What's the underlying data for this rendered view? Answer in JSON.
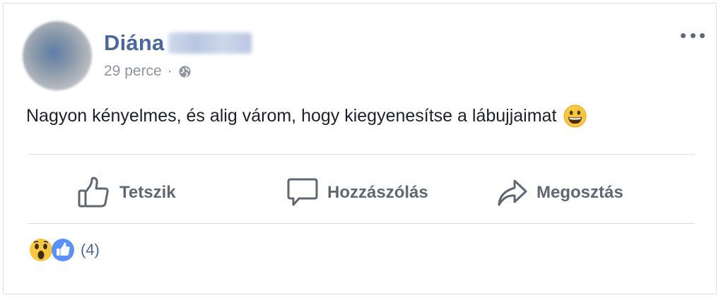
{
  "post": {
    "author": "Diána",
    "time": "29 perce",
    "separator": "·",
    "privacy_icon": "globe-icon",
    "menu_icon": "more-options-icon",
    "text": "Nagyon kényelmes, és alig várom, hogy kiegyenesítse a lábujjaimat",
    "text_emoji": "grinning-face-emoji"
  },
  "actions": {
    "like_label": "Tetszik",
    "comment_label": "Hozzászólás",
    "share_label": "Megosztás"
  },
  "reactions": {
    "icons": [
      "wow-reaction-icon",
      "like-reaction-icon"
    ],
    "count": "(4)"
  },
  "colors": {
    "author": "#4b67a1",
    "meta": "#90949c",
    "text": "#1d2129",
    "action": "#606770",
    "like_blue": "#5890ff"
  }
}
